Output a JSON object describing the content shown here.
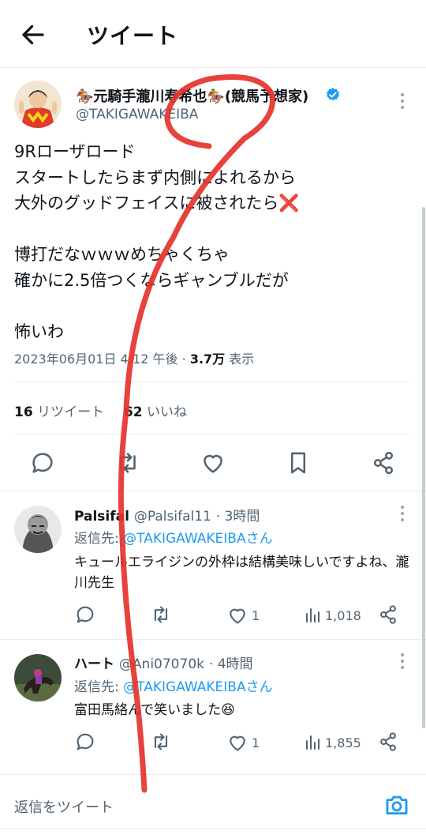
{
  "header": {
    "title": "ツイート"
  },
  "tweet": {
    "author_name": "🏇元騎手瀧川寿希也🏇(競馬予想家)",
    "author_handle": "@TAKIGAWAKEIBA",
    "text": "9Rローザロード\nスタートしたらまず内側によれるから\n大外のグッドフェイスに被されたら❌\n\n博打だなｗｗｗめちゃくちゃ\n確かに2.5倍つくならギャンブルだが\n\n怖いわ",
    "date": "2023年06月01日 4:12 午後",
    "views_count": "3.7万",
    "views_label": "表示",
    "retweets_count": "16",
    "retweets_label": "リツイート",
    "likes_count": "62",
    "likes_label": "いいね"
  },
  "replies": [
    {
      "name": "Palsifal",
      "handle": "@Palsifal11",
      "time": "· 3時間",
      "reply_to_label": "返信先: ",
      "reply_to": "@TAKIGAWAKEIBAさん",
      "text": "キュールエライジンの外枠は結構美味しいですよね、瀧川先生",
      "likes": "1",
      "views": "1,018"
    },
    {
      "name": "ハート",
      "handle": "@Ani07070k",
      "time": "· 4時間",
      "reply_to_label": "返信先: ",
      "reply_to": "@TAKIGAWAKEIBAさん",
      "text": "富田馬絡んで笑いました😆",
      "likes": "1",
      "views": "1,855"
    }
  ],
  "compose": {
    "placeholder": "返信をツイート"
  },
  "icons": {
    "back": "arrow-left-icon",
    "verified": "verified-badge-icon",
    "reply": "comment-icon",
    "retweet": "retweet-icon",
    "like": "heart-icon",
    "bookmark": "bookmark-icon",
    "share": "share-icon",
    "views": "bar-chart-icon",
    "camera": "camera-icon"
  },
  "colors": {
    "accent": "#1d9bf0",
    "secondary_text": "#536471",
    "scribble": "#e5322b"
  }
}
